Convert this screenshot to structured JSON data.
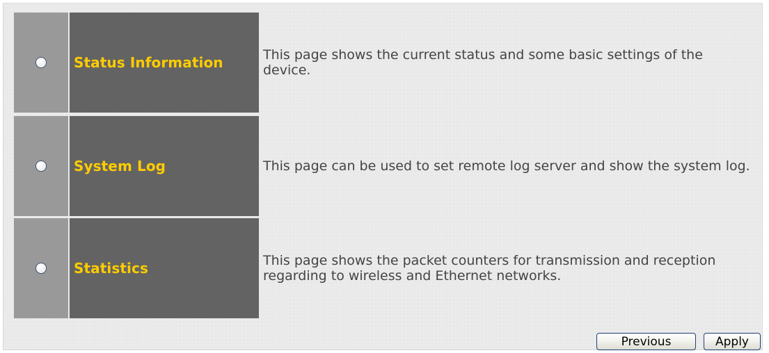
{
  "options": [
    {
      "label": "Status Information",
      "description": "This page shows the current status and some basic settings of the device.",
      "selected": false
    },
    {
      "label": "System Log",
      "description": "This page can be used to set remote log server and show the system log.",
      "selected": false
    },
    {
      "label": "Statistics",
      "description": "This page shows the packet counters for transmission and reception regarding to wireless and Ethernet networks.",
      "selected": false
    }
  ],
  "buttons": {
    "previous_label": "Previous",
    "apply_label": "Apply"
  },
  "colors": {
    "radio_column": "#999999",
    "label_column": "#636363",
    "label_text": "#ffcc00",
    "description_text": "#444444",
    "button_border": "#1c3f73"
  }
}
